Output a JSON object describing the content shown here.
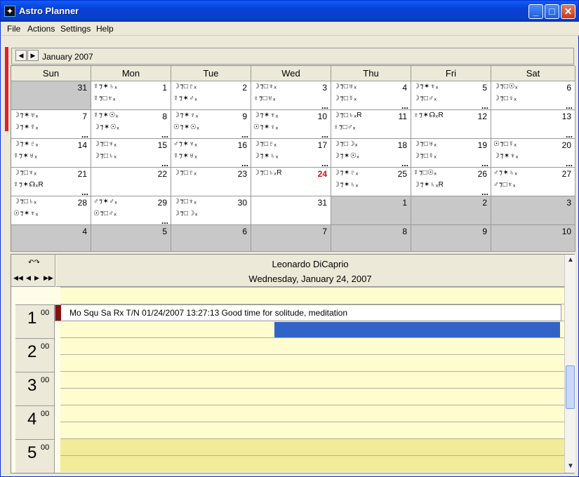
{
  "window": {
    "title": "Astro Planner",
    "minimize": "_",
    "maximize": "□",
    "close": "✕",
    "app_icon": "✦"
  },
  "menu": [
    "File",
    "Actions",
    "Settings",
    "Help"
  ],
  "nav": {
    "prev": "◀",
    "next": "▶",
    "month": "January 2007"
  },
  "weekdays": [
    "Sun",
    "Mon",
    "Tue",
    "Wed",
    "Thu",
    "Fri",
    "Sat"
  ],
  "weeks": [
    [
      {
        "day": "31",
        "gray": true,
        "l1": "",
        "l2": "",
        "more": false
      },
      {
        "day": "1",
        "l1": "☿⁊✶♄ₓ",
        "l2": "☿⁊□♆ₓ",
        "more": false
      },
      {
        "day": "2",
        "l1": "☽⁊□♇ₓ",
        "l2": "☿⁊✶♂ₓ",
        "more": false
      },
      {
        "day": "3",
        "l1": "☽⁊□♆ₓ",
        "l2": "♀⁊□♅ₓ",
        "more": true
      },
      {
        "day": "4",
        "l1": "☽⁊□♅ₓ",
        "l2": "☽⁊□☿ₓ",
        "more": true
      },
      {
        "day": "5",
        "l1": "☽⁊✶♆ₓ",
        "l2": "☽⁊□♂ₓ",
        "more": true
      },
      {
        "day": "6",
        "l1": "☽⁊□☉ₓ",
        "l2": "☽⁊□♀ₓ",
        "more": true
      }
    ],
    [
      {
        "day": "7",
        "l1": "☽⁊✶♅ₓ",
        "l2": "☽⁊✶☿ₓ",
        "more": true
      },
      {
        "day": "8",
        "l1": "☿⁊✶☉ₓ",
        "l2": "☽⁊✶☉ₓ",
        "more": true
      },
      {
        "day": "9",
        "l1": "☽⁊✶♀ₓ",
        "l2": "☉⁊✶☉ₓ",
        "more": true
      },
      {
        "day": "10",
        "l1": "☽⁊✶♆ₓ",
        "l2": "☉⁊✶♀ₓ",
        "more": true
      },
      {
        "day": "11",
        "l1": "☽⁊□♄ₓR",
        "l2": "♀⁊□♂ₓ",
        "more": false
      },
      {
        "day": "12",
        "l1": "♀⁊✶☊ₓR",
        "l2": "",
        "more": false
      },
      {
        "day": "13",
        "l1": "",
        "l2": "",
        "more": true
      }
    ],
    [
      {
        "day": "14",
        "l1": "☽⁊✶♇ₓ",
        "l2": "☿⁊✶♅ₓ",
        "more": false
      },
      {
        "day": "15",
        "l1": "☽⁊□♆ₓ",
        "l2": "☽⁊□♄ₓ",
        "more": true
      },
      {
        "day": "16",
        "l1": "♂⁊✶♆ₓ",
        "l2": "☿⁊✶♅ₓ",
        "more": true
      },
      {
        "day": "17",
        "l1": "☽⁊□♇ₓ",
        "l2": "☽⁊✶♄ₓ",
        "more": true
      },
      {
        "day": "18",
        "l1": "☽⁊□☽ₓ",
        "l2": "☽⁊✶☉ₓ",
        "more": true
      },
      {
        "day": "19",
        "l1": "☽⁊□♅ₓ",
        "l2": "☽⁊□☿ₓ",
        "more": true
      },
      {
        "day": "20",
        "l1": "☉⁊□☿ₓ",
        "l2": "☽⁊✶♆ₓ",
        "more": true
      }
    ],
    [
      {
        "day": "21",
        "l1": "☽⁊□♆ₓ",
        "l2": "☿⁊✶☊ₓR",
        "more": true
      },
      {
        "day": "22",
        "l1": "",
        "l2": "",
        "more": false
      },
      {
        "day": "23",
        "l1": "☽⁊□♇ₓ",
        "l2": "",
        "more": false
      },
      {
        "day": "24",
        "red": true,
        "l1": "☽⁊□♄ₓR",
        "l2": "",
        "more": false
      },
      {
        "day": "25",
        "l1": "☽⁊✶♇ₓ",
        "l2": "☽⁊✶♄ₓ",
        "more": false
      },
      {
        "day": "26",
        "l1": "☿⁊□☉ₓ",
        "l2": "☽⁊✶♄ₓR",
        "more": true
      },
      {
        "day": "27",
        "l1": "♂⁊✶♄ₓ",
        "l2": "♂⁊□♆ₓ",
        "more": false
      }
    ],
    [
      {
        "day": "28",
        "l1": "☽⁊□♄ₓ",
        "l2": "☉⁊✶♆ₓ",
        "more": false
      },
      {
        "day": "29",
        "l1": "♂⁊✶♂ₓ",
        "l2": "☉⁊□♂ₓ",
        "more": true
      },
      {
        "day": "30",
        "l1": "☽⁊□♆ₓ",
        "l2": "☽⁊□☽ₓ",
        "more": false
      },
      {
        "day": "31",
        "l1": "",
        "l2": "",
        "more": false
      },
      {
        "day": "1",
        "gray": true,
        "l1": "",
        "l2": "",
        "more": false
      },
      {
        "day": "2",
        "gray": true,
        "l1": "",
        "l2": "",
        "more": false
      },
      {
        "day": "3",
        "gray": true,
        "l1": "",
        "l2": "",
        "more": false
      }
    ],
    [
      {
        "day": "4",
        "gray": true,
        "l1": "",
        "l2": "",
        "more": false
      },
      {
        "day": "5",
        "gray": true,
        "l1": "",
        "l2": "",
        "more": false
      },
      {
        "day": "6",
        "gray": true,
        "l1": "",
        "l2": "",
        "more": false
      },
      {
        "day": "7",
        "gray": true,
        "l1": "",
        "l2": "",
        "more": false
      },
      {
        "day": "8",
        "gray": true,
        "l1": "",
        "l2": "",
        "more": false
      },
      {
        "day": "9",
        "gray": true,
        "l1": "",
        "l2": "",
        "more": false
      },
      {
        "day": "10",
        "gray": true,
        "l1": "",
        "l2": "",
        "more": false
      }
    ]
  ],
  "more_glyph": "...",
  "day_view": {
    "person": "Leonardo DiCaprio",
    "date": "Wednesday, January 24, 2007",
    "loop_icon": "↶↷",
    "nav_icons": [
      "◀◀",
      "◀",
      "▶",
      "▶▶"
    ],
    "hours": [
      {
        "num": "1",
        "min": "00"
      },
      {
        "num": "2",
        "min": "00"
      },
      {
        "num": "3",
        "min": "00"
      },
      {
        "num": "4",
        "min": "00"
      },
      {
        "num": "5",
        "min": "00"
      }
    ],
    "event": {
      "text": "Mo Squ Sa Rx T/N 01/24/2007 13:27:13   Good time for solitude, meditation"
    },
    "scroll_up": "▲",
    "scroll_down": "▼"
  }
}
